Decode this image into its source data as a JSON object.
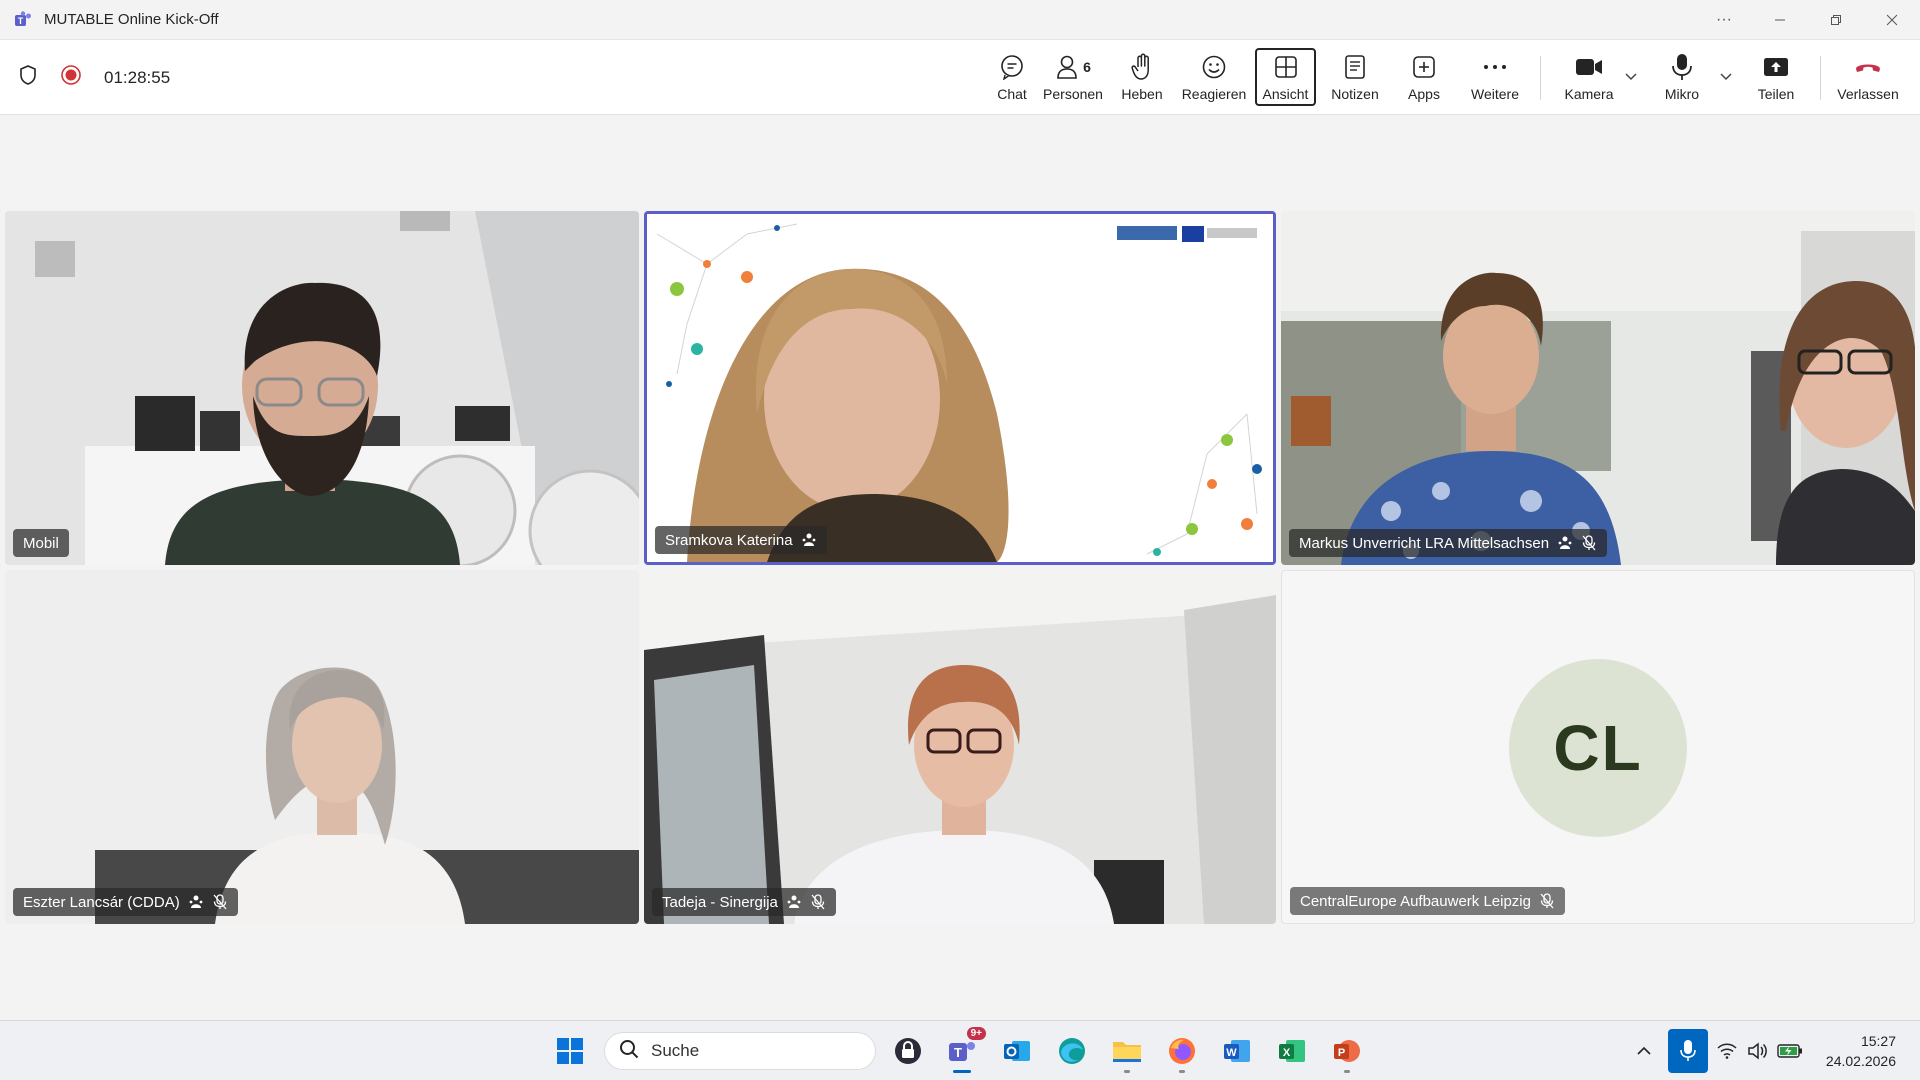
{
  "window": {
    "title": "MUTABLE Online Kick-Off",
    "more_label": "···"
  },
  "toolbar": {
    "timer": "01:28:55",
    "people_count": "6",
    "buttons": {
      "chat": "Chat",
      "people": "Personen",
      "raise": "Heben",
      "react": "Reagieren",
      "view": "Ansicht",
      "notes": "Notizen",
      "apps": "Apps",
      "more": "Weitere",
      "camera": "Kamera",
      "mic": "Mikro",
      "share": "Teilen",
      "leave": "Verlassen"
    }
  },
  "participants": [
    {
      "name": "Mobil"
    },
    {
      "name": "Sramkova Katerina"
    },
    {
      "name": "Markus Unverricht LRA Mittelsachsen"
    },
    {
      "name": "Eszter Lancsár (CDDA)"
    },
    {
      "name": "Tadeja - Sinergija"
    },
    {
      "name": "CentralEurope Aufbauwerk Leipzig",
      "initials": "CL"
    }
  ],
  "taskbar": {
    "search_placeholder": "Suche",
    "teams_badge": "9+",
    "time": "15:27",
    "date": "24.02.2026"
  },
  "colors": {
    "accent": "#5b5fc7",
    "leave_red": "#c4314b",
    "record_red": "#d13438",
    "avatar_bg": "#dde3d3",
    "avatar_text": "#2b3a1e"
  }
}
